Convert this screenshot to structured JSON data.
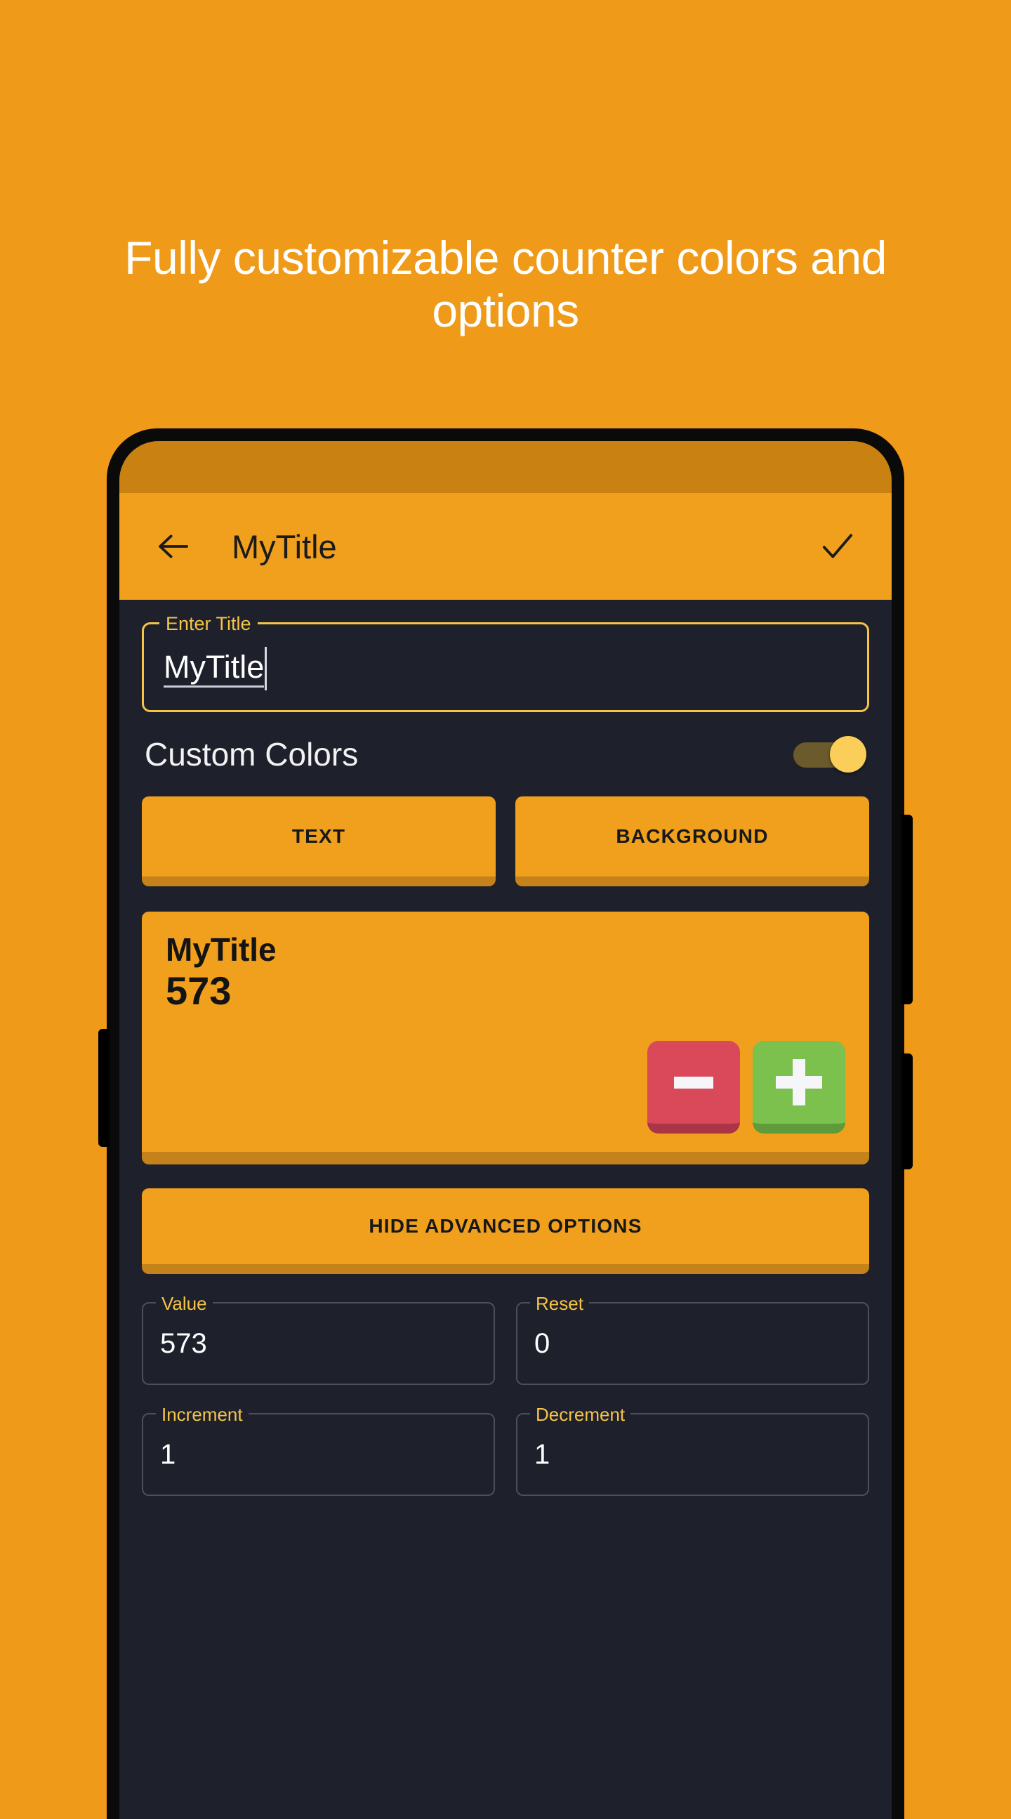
{
  "promo": {
    "headline": "Fully customizable counter colors and options",
    "background_color": "#F09A19",
    "headline_color": "#FFFFFF"
  },
  "theme": {
    "accent": "#F0A01D",
    "accent_dark": "#C5821A",
    "screen_bg": "#1e212b",
    "label_yellow": "#F5C347",
    "status_bar": "#C98212",
    "minus_red": "#D9495A",
    "plus_green": "#7CC04E"
  },
  "appbar": {
    "back_icon": "arrow-left-icon",
    "title": "MyTitle",
    "confirm_icon": "check-icon"
  },
  "title_field": {
    "label": "Enter Title",
    "value": "MyTitle",
    "placeholder": "Enter Title"
  },
  "custom_colors": {
    "label": "Custom Colors",
    "enabled": true,
    "buttons": [
      {
        "label": "TEXT",
        "name": "text-color-button"
      },
      {
        "label": "BACKGROUND",
        "name": "background-color-button"
      }
    ]
  },
  "counter_preview": {
    "title": "MyTitle",
    "value": "573",
    "decrement_icon": "minus-icon",
    "increment_icon": "plus-icon"
  },
  "advanced": {
    "toggle_label": "HIDE ADVANCED OPTIONS",
    "fields": [
      {
        "label": "Value",
        "value": "573",
        "name": "value-field"
      },
      {
        "label": "Reset",
        "value": "0",
        "name": "reset-field"
      },
      {
        "label": "Increment",
        "value": "1",
        "name": "increment-field"
      },
      {
        "label": "Decrement",
        "value": "1",
        "name": "decrement-field"
      }
    ]
  }
}
